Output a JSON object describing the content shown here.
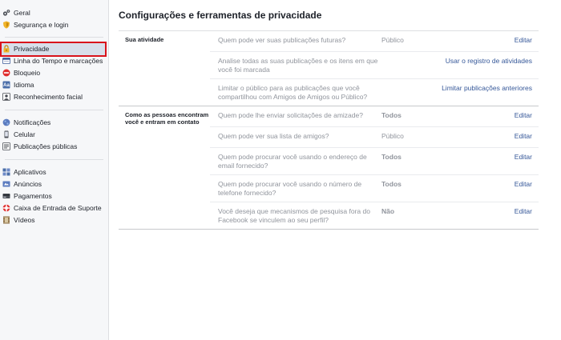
{
  "sidebar": {
    "groups": [
      {
        "items": [
          {
            "label": "Geral",
            "icon": "gears-icon"
          },
          {
            "label": "Segurança e login",
            "icon": "shield-icon"
          }
        ]
      },
      {
        "items": [
          {
            "label": "Privacidade",
            "icon": "lock-icon",
            "selected": true
          },
          {
            "label": "Linha do Tempo e marcações",
            "icon": "timeline-icon"
          },
          {
            "label": "Bloqueio",
            "icon": "block-icon"
          },
          {
            "label": "Idioma",
            "icon": "language-icon"
          },
          {
            "label": "Reconhecimento facial",
            "icon": "face-recognition-icon"
          }
        ]
      },
      {
        "items": [
          {
            "label": "Notificações",
            "icon": "globe-icon"
          },
          {
            "label": "Celular",
            "icon": "mobile-icon"
          },
          {
            "label": "Publicações públicas",
            "icon": "rss-icon"
          }
        ]
      },
      {
        "items": [
          {
            "label": "Aplicativos",
            "icon": "apps-icon"
          },
          {
            "label": "Anúncios",
            "icon": "ads-icon"
          },
          {
            "label": "Pagamentos",
            "icon": "payments-icon"
          },
          {
            "label": "Caixa de Entrada de Suporte",
            "icon": "support-icon"
          },
          {
            "label": "Vídeos",
            "icon": "video-icon"
          }
        ]
      }
    ]
  },
  "main": {
    "title": "Configurações e ferramentas de privacidade",
    "sections": [
      {
        "label": "Sua atividade",
        "rows": [
          {
            "question": "Quem pode ver suas publicações futuras?",
            "value": "Público",
            "action": "Editar"
          },
          {
            "question": "Analise todas as suas publicações e os itens em que você foi marcada",
            "value": "",
            "action": "Usar o registro de atividades"
          },
          {
            "question": "Limitar o público para as publicações que você compartilhou com Amigos de Amigos ou Público?",
            "value": "",
            "action": "Limitar publicações anteriores"
          }
        ]
      },
      {
        "label": "Como as pessoas encontram você e entram em contato",
        "rows": [
          {
            "question": "Quem pode lhe enviar solicitações de amizade?",
            "value": "Todos",
            "action": "Editar"
          },
          {
            "question": "Quem pode ver sua lista de amigos?",
            "value": "Público",
            "action": "Editar"
          },
          {
            "question": "Quem pode procurar você usando o endereço de email fornecido?",
            "value": "Todos",
            "action": "Editar"
          },
          {
            "question": "Quem pode procurar você usando o número de telefone fornecido?",
            "value": "Todos",
            "action": "Editar"
          },
          {
            "question": "Você deseja que mecanismos de pesquisa fora do Facebook se vinculem ao seu perfil?",
            "value": "Não",
            "action": "Editar"
          }
        ]
      }
    ]
  },
  "colors": {
    "link": "#365899",
    "muted": "#90949c",
    "selected_bg": "#d8dfea",
    "highlight_outline": "#d9121b"
  }
}
